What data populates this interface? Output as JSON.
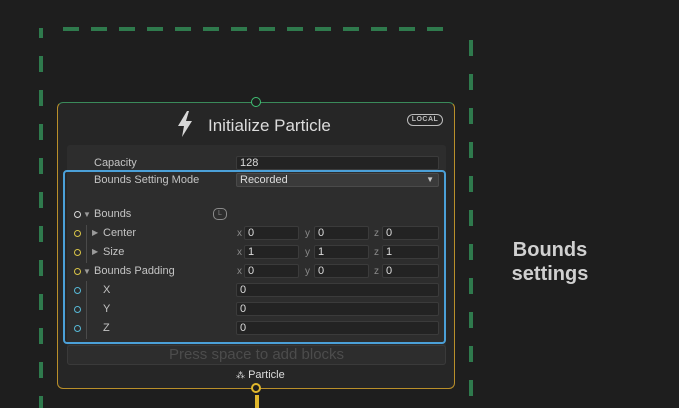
{
  "node": {
    "title": "Initialize Particle",
    "space_badge": "LOCAL",
    "placeholder": "Press space to add blocks",
    "output_label": "Particle"
  },
  "settings": {
    "capacity_label": "Capacity",
    "capacity_value": "128",
    "bounds_mode_label": "Bounds Setting Mode",
    "bounds_mode_value": "Recorded"
  },
  "bounds": {
    "label": "Bounds",
    "space_badge": "L",
    "center_label": "Center",
    "center": {
      "x": "0",
      "y": "0",
      "z": "0"
    },
    "size_label": "Size",
    "size": {
      "x": "1",
      "y": "1",
      "z": "1"
    }
  },
  "padding": {
    "label": "Bounds Padding",
    "values": {
      "x": "0",
      "y": "0",
      "z": "0"
    },
    "x_label": "X",
    "x_value": "0",
    "y_label": "Y",
    "y_value": "0",
    "z_label": "Z",
    "z_value": "0"
  },
  "axes": {
    "x": "x",
    "y": "y",
    "z": "z"
  },
  "caption": {
    "line1": "Bounds",
    "line2": "settings"
  },
  "colors": {
    "system_outline": "#2f7a4d",
    "highlight": "#4ba0d8",
    "flow_port": "#e0b72c",
    "property_port": "#d8c447",
    "float_port": "#57b8d6"
  }
}
